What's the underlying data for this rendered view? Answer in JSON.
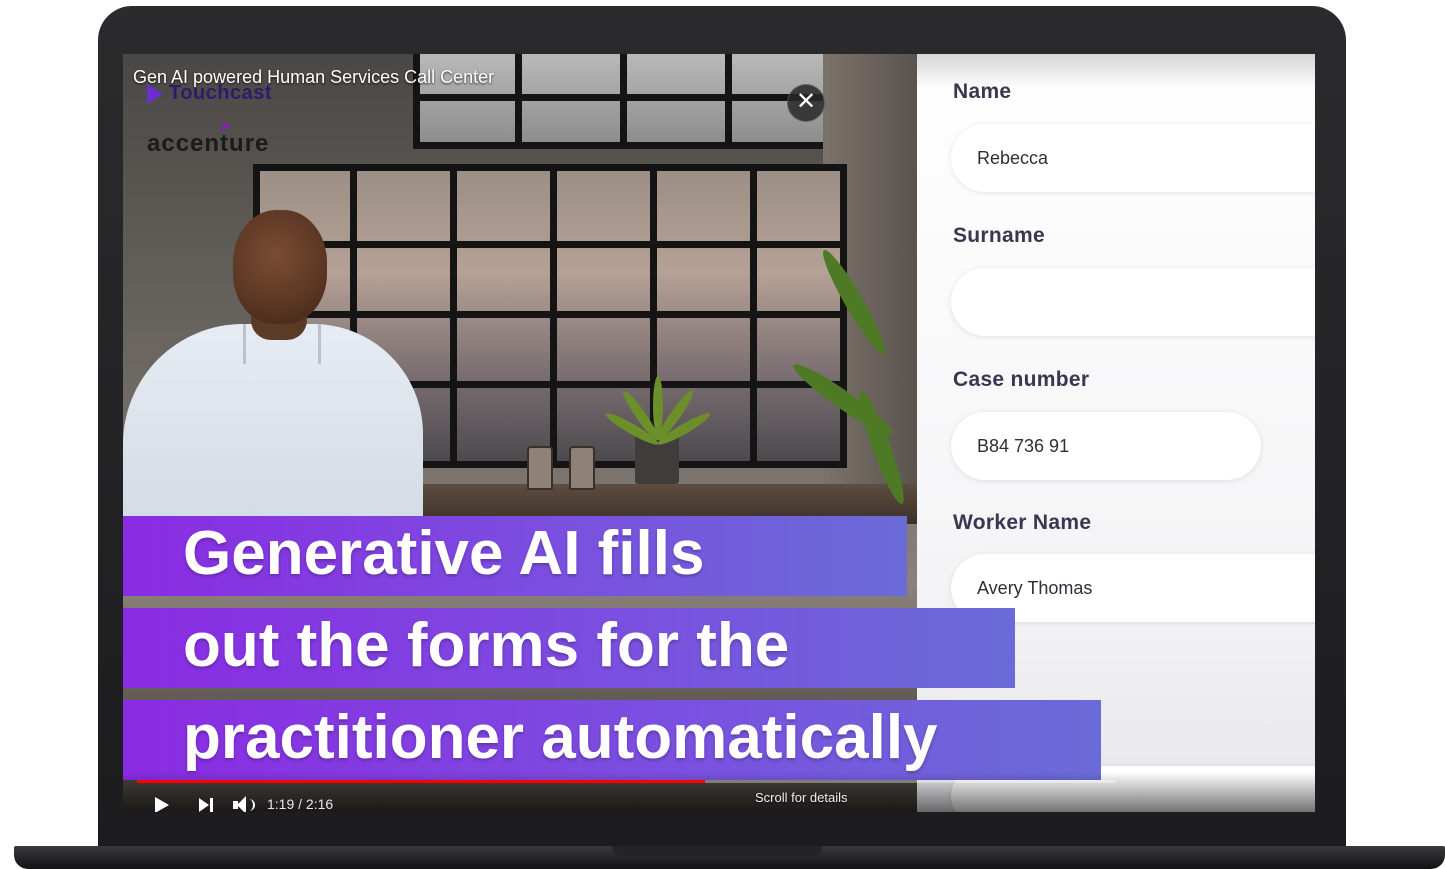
{
  "video": {
    "title": "Gen AI powered Human Services Call Center",
    "close_symbol": "✕",
    "brand_touchcast": "Touchcast",
    "brand_accenture": "accenture",
    "brand_chevron": ">"
  },
  "captions": [
    "Generative AI fills",
    "out the forms for the",
    "practitioner automatically"
  ],
  "form": {
    "fields": [
      {
        "label": "Name",
        "value": "Rebecca"
      },
      {
        "label": "Surname",
        "value": ""
      },
      {
        "label": "Case number",
        "value": "B84 736 91"
      },
      {
        "label": "Worker Name",
        "value": "Avery Thomas"
      }
    ]
  },
  "player": {
    "time": "1:19 / 2:16",
    "progress_fraction": 0.581,
    "scroll_hint": "Scroll for details",
    "accent_color": "#ff0000"
  },
  "icons": [
    "close-icon",
    "play-icon",
    "next-icon",
    "volume-icon",
    "touchcast-logo-icon"
  ]
}
